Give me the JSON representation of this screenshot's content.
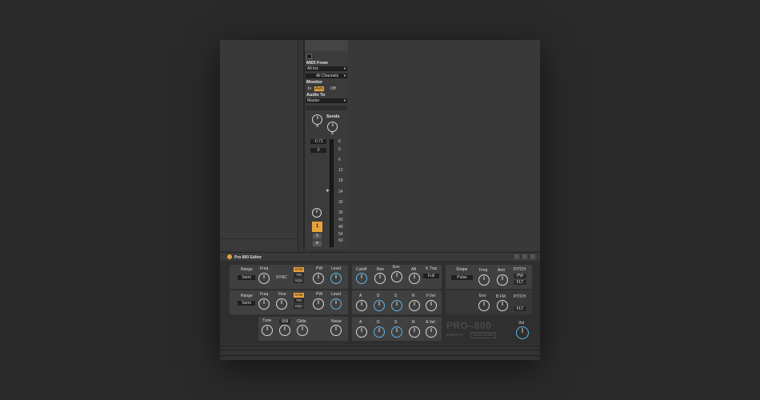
{
  "track": {
    "midi_from_label": "MIDI From",
    "midi_from_value": "All Ins",
    "channels_value": "All Channels",
    "monitor_label": "Monitor",
    "monitor_in": "In",
    "monitor_auto": "Auto",
    "monitor_off": "Off",
    "audio_to_label": "Audio To",
    "audio_to_value": "Master",
    "sends_label": "Sends",
    "send_a": "A",
    "send_b": "B",
    "volume": "-0.71",
    "pan": "0",
    "track_number": "1",
    "solo": "S",
    "arm": "⊘",
    "meter_scale": [
      "6",
      "0",
      "6",
      "12",
      "18",
      "24",
      "30",
      "36",
      "42",
      "48",
      "54",
      "60"
    ]
  },
  "device": {
    "title": "Pro 800 Editor",
    "osc1": {
      "range_label": "Range",
      "range_value": "Semi",
      "freq": "Freq",
      "sync": "SYNC",
      "saw": "SAW",
      "tri": "TRI",
      "squ": "SQU",
      "pw": "PW",
      "level": "Level"
    },
    "osc2": {
      "range_label": "Range",
      "range_value": "Semi",
      "freq": "Freq",
      "fine": "Fine",
      "saw": "SAW",
      "tri": "TRI",
      "squ": "SQU",
      "pw": "PW",
      "level": "Level"
    },
    "misc": {
      "tune": "Tune",
      "uni": "UNI",
      "glide": "Glide",
      "noise": "Noise"
    },
    "filter": {
      "cutoff": "Cutoff",
      "res": "Res",
      "env": "Env",
      "aft": "Aft",
      "ktrac": "K.Trac",
      "ktrac_value": "Full"
    },
    "fenv": {
      "a": "A",
      "d": "D",
      "s": "S",
      "r": "R",
      "fvel": "F.Vel"
    },
    "aenv": {
      "a": "A",
      "d": "D",
      "s": "S",
      "r": "R",
      "avel": "A.Vel"
    },
    "lfo": {
      "shape": "Shape",
      "shape_value": "Pulse",
      "freq": "Freq",
      "amt": "Amt",
      "pitch": "PITCH",
      "pw": "PW",
      "flt": "FLT"
    },
    "pmod": {
      "env": "Env",
      "bfm": "B FM",
      "pitch": "PITCH",
      "flt": "FLT"
    },
    "brand": "PRO–800",
    "credit_prefix": "Edited by",
    "credit_name": "Sonic Audio",
    "vol": "Vol"
  },
  "colors": {
    "accent_orange": "#e8a23a",
    "knob_blue": "#5eb6e6"
  }
}
